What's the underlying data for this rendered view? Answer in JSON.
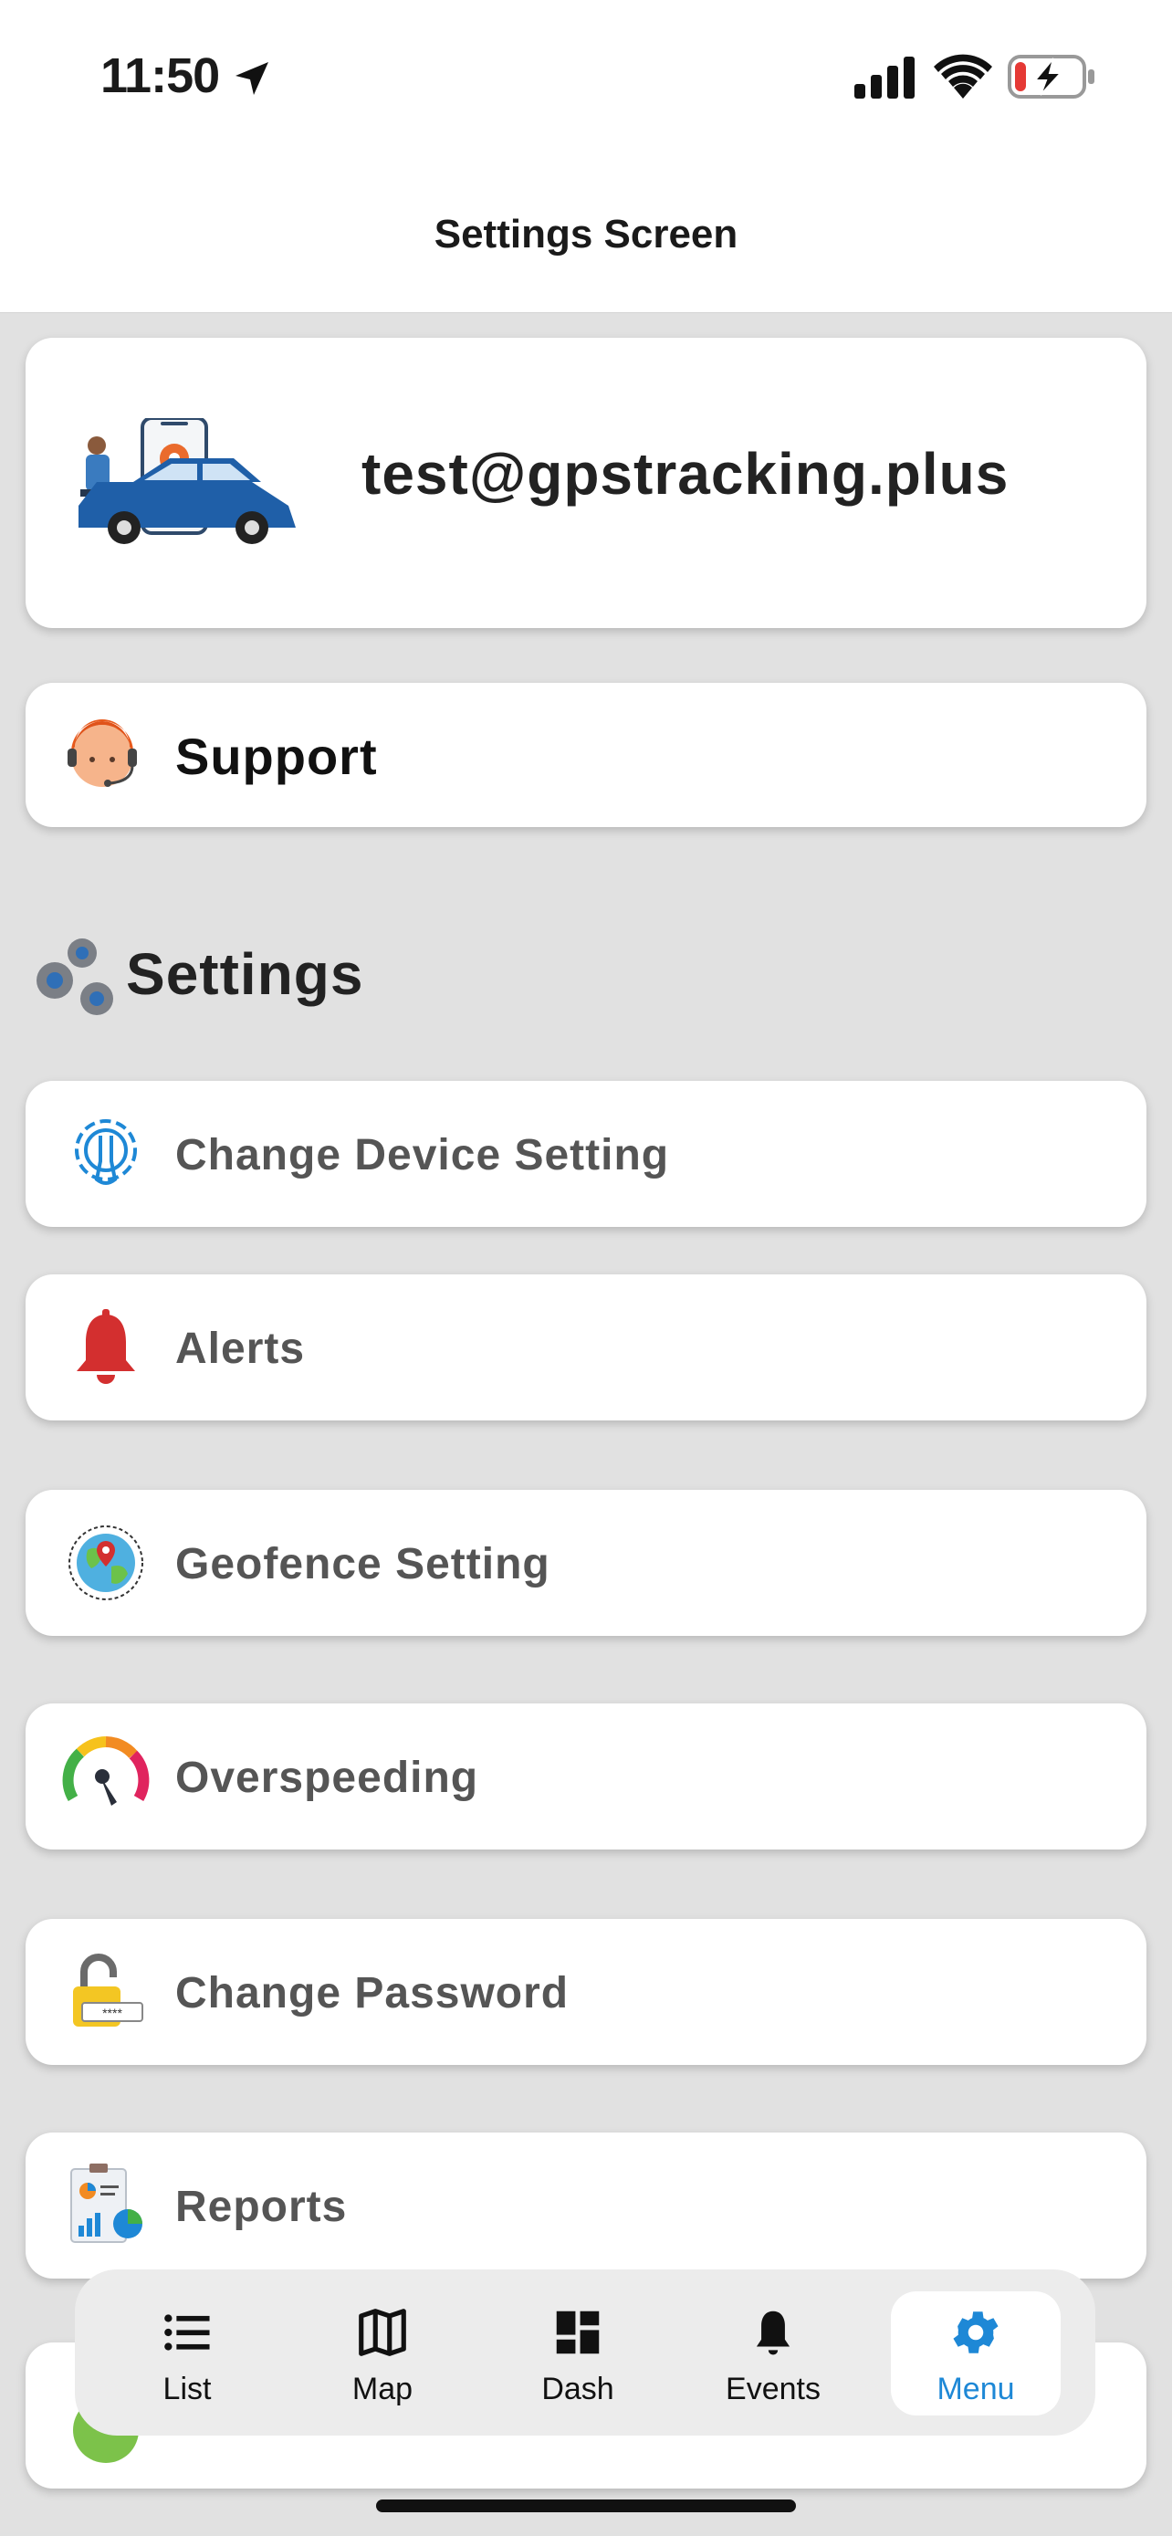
{
  "status_bar": {
    "time": "11:50"
  },
  "header": {
    "title": "Settings Screen"
  },
  "profile": {
    "email": "test@gpstracking.plus"
  },
  "support": {
    "label": "Support"
  },
  "settings_section": {
    "title": "Settings"
  },
  "menu_items": [
    {
      "label": "Change Device Setting",
      "icon": "gear-wrench-icon"
    },
    {
      "label": "Alerts",
      "icon": "bell-icon"
    },
    {
      "label": "Geofence Setting",
      "icon": "globe-pin-icon"
    },
    {
      "label": "Overspeeding",
      "icon": "speedometer-icon"
    },
    {
      "label": "Change Password",
      "icon": "padlock-icon"
    },
    {
      "label": "Reports",
      "icon": "report-chart-icon"
    }
  ],
  "tabs": [
    {
      "label": "List",
      "icon": "list-icon"
    },
    {
      "label": "Map",
      "icon": "map-icon"
    },
    {
      "label": "Dash",
      "icon": "dashboard-icon"
    },
    {
      "label": "Events",
      "icon": "bell-icon"
    },
    {
      "label": "Menu",
      "icon": "gear-icon",
      "active": true
    }
  ],
  "colors": {
    "accent": "#1e88d6",
    "background": "#e1e1e1",
    "card": "#ffffff",
    "alert_red": "#d32f2f"
  }
}
